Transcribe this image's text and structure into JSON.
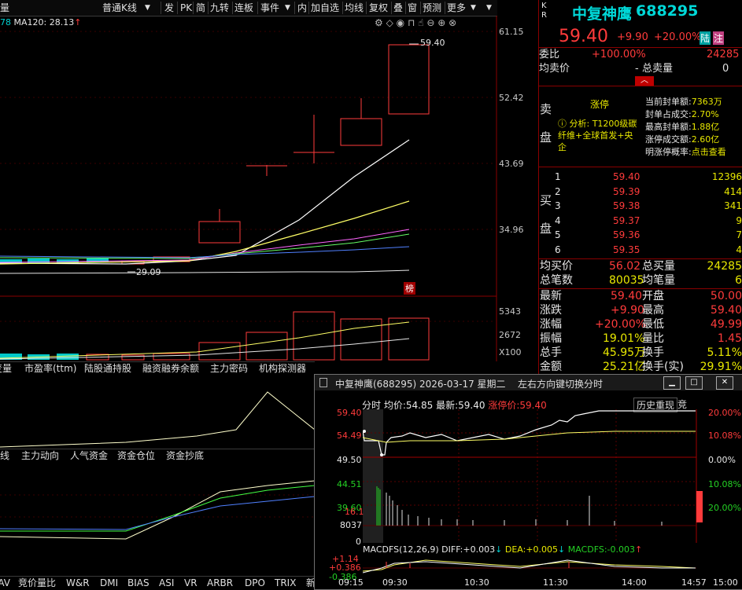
{
  "toolbar": {
    "left_cut": "量",
    "kline_type": "普通K线",
    "items": [
      "发",
      "PK",
      "简",
      "九转",
      "连板",
      "事件",
      "内",
      "加自选",
      "均线",
      "复权",
      "叠",
      "窗",
      "预测",
      "更多"
    ]
  },
  "ma_row": {
    "left_value": "78",
    "ma120_label": "MA120: 28.13"
  },
  "price_axis": [
    "61.15",
    "52.42",
    "43.69",
    "34.96"
  ],
  "annotations": {
    "high_marker": "59.40",
    "low_marker": "29.09",
    "bang_badge": "榜"
  },
  "volume_axis": [
    "5343",
    "2672",
    "X100"
  ],
  "indicator_tabs": [
    "变量",
    "市盈率(ttm)",
    "陆股通持股",
    "融资融券余额",
    "主力密码",
    "机构探测器"
  ],
  "indicator_tabs2": [
    "线",
    "主力动向",
    "人气资金",
    "资金仓位",
    "资金抄底"
  ],
  "bottom_tabs": [
    "MAV",
    "竞价量比",
    "W&R",
    "DMI",
    "BIAS",
    "ASI",
    "VR",
    "ARBR",
    "DPO",
    "TRIX",
    "新"
  ],
  "quote": {
    "side_letters": [
      "K",
      "R"
    ],
    "name": "中复神鹰",
    "code": "688295",
    "price": "59.40",
    "change": "+9.90",
    "change_pct": "+20.00%",
    "tag_lu": "陆",
    "tag_zhu": "注",
    "weibi_label": "委比",
    "weibi_value": "+100.00%",
    "weicha_value": "24285",
    "avg_sell_label": "均卖价",
    "avg_sell_value": "-",
    "total_sell_label": "总卖量",
    "total_sell_value": "0",
    "sell_side_label": [
      "卖",
      "盘"
    ],
    "zhangting": "涨停",
    "fenxi_text": "分析: T1200级碳纤维+全球首发+央企",
    "stats": [
      {
        "label": "当前封单额:",
        "value": "7363万"
      },
      {
        "label": "封单占成交:",
        "value": "2.70%"
      },
      {
        "label": "最高封单额:",
        "value": "1.88亿"
      },
      {
        "label": "涨停成交额:",
        "value": "2.60亿"
      },
      {
        "label": "明涨停概率:",
        "value": "点击查看"
      }
    ],
    "buy_side_label": [
      "买",
      "盘"
    ],
    "bids": [
      {
        "lvl": "1",
        "price": "59.40",
        "vol": "12396"
      },
      {
        "lvl": "2",
        "price": "59.39",
        "vol": "414"
      },
      {
        "lvl": "3",
        "price": "59.38",
        "vol": "341"
      },
      {
        "lvl": "4",
        "price": "59.37",
        "vol": "9"
      },
      {
        "lvl": "5",
        "price": "59.36",
        "vol": "7"
      },
      {
        "lvl": "6",
        "price": "59.35",
        "vol": "4"
      }
    ],
    "summary1": [
      {
        "l": "均买价",
        "v": "56.02",
        "l2": "总买量",
        "v2": "24285"
      },
      {
        "l": "总笔数",
        "v": "80035",
        "l2": "均笔量",
        "v2": "6"
      }
    ],
    "summary2": [
      {
        "l": "最新",
        "v": "59.40",
        "l2": "开盘",
        "v2": "50.00"
      },
      {
        "l": "涨跌",
        "v": "+9.90",
        "l2": "最高",
        "v2": "59.40"
      },
      {
        "l": "涨幅",
        "v": "+20.00%",
        "l2": "最低",
        "v2": "49.99"
      },
      {
        "l": "振幅",
        "v": "19.01%",
        "l2": "量比",
        "v2": "1.45"
      },
      {
        "l": "总手",
        "v": "45.95万",
        "l2": "换手",
        "v2": "5.11%"
      },
      {
        "l": "金额",
        "v": "25.21亿",
        "l2": "换手(实)",
        "v2": "29.91%"
      }
    ]
  },
  "popup": {
    "title": "中复神鹰(688295) 2026-03-17 星期二",
    "hint": "左右方向键切换分时",
    "header": {
      "fs": "分时",
      "avg_label": "均价:",
      "avg": "54.85",
      "last_label": "最新:",
      "last": "59.40",
      "limit_label": "涨停价:",
      "limit": "59.40"
    },
    "history_btn": "历史重现",
    "cut_btn": "竞",
    "left_axis": [
      "59.40",
      "54.49",
      "49.50",
      "44.51",
      "39.60"
    ],
    "right_axis": [
      "20.00%",
      "10.08%",
      "0.00%",
      "10.08%",
      "20.00%"
    ],
    "vol_axis": [
      "16.1",
      "8037",
      "0"
    ],
    "macd": {
      "label": "MACDFS(12,26,9)",
      "diff_label": "DIFF:",
      "diff": "+0.003",
      "dea_label": "DEA:",
      "dea": "+0.005",
      "macd_label": "MACDFS:",
      "macd": "-0.003"
    },
    "macd_axis": [
      "+1.14",
      "+0.386",
      "-0.386"
    ],
    "time_axis": [
      "09:15",
      "09:30",
      "10:30",
      "11:30",
      "14:00",
      "14:57",
      "15:00"
    ]
  }
}
